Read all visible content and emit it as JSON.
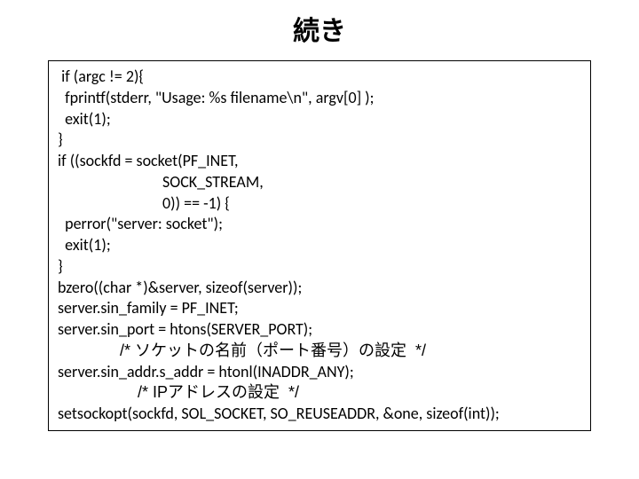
{
  "title": "続き",
  "code": {
    "l1": " if (argc != 2){",
    "l2": "  fprintf(stderr, \"Usage: %s filename\\n\", argv[0] );",
    "l3": "  exit(1);",
    "l4": "}",
    "l5": "if ((sockfd = socket(PF_INET,",
    "l6": "                             SOCK_STREAM,",
    "l7": "                             0)) == -1) {",
    "l8": "  perror(\"server: socket\");",
    "l9": "  exit(1);",
    "l10": "}",
    "l11": "bzero((char *)&server, sizeof(server));",
    "l12": "server.sin_family = PF_INET;",
    "l13": "server.sin_port = htons(SERVER_PORT);",
    "l14": "              /* ソケットの名前（ポート番号）の設定  */",
    "l15": "server.sin_addr.s_addr = htonl(INADDR_ANY);",
    "l16": "                  /* IPアドレスの設定  */",
    "l17": "setsockopt(sockfd, SOL_SOCKET, SO_REUSEADDR, &one, sizeof(int));"
  }
}
